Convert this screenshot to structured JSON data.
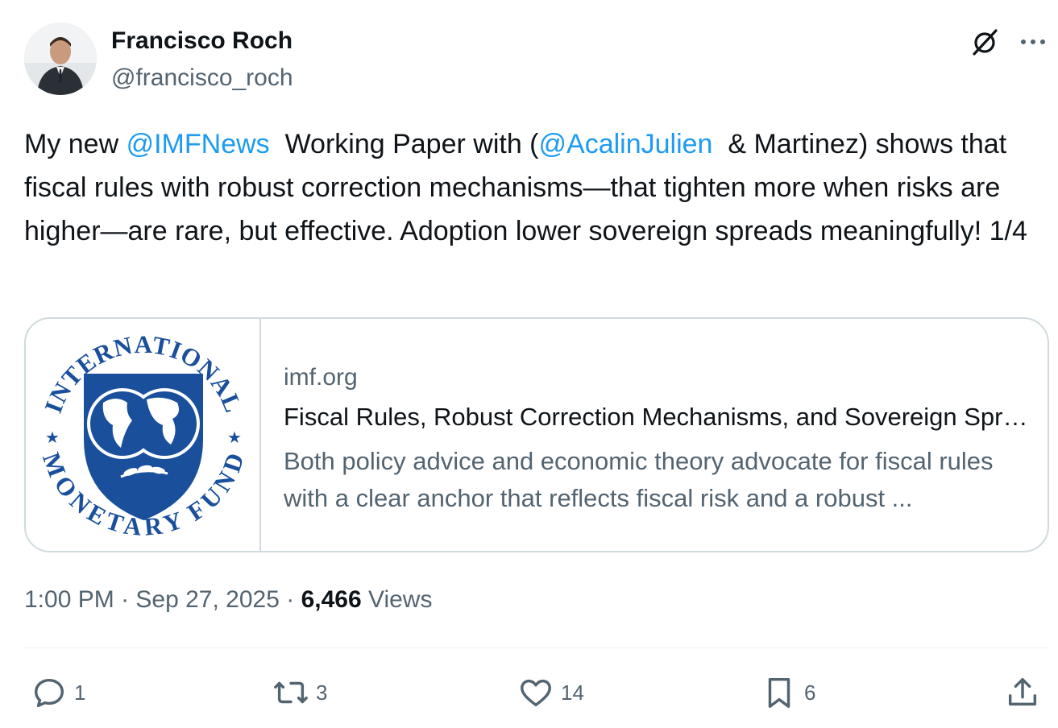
{
  "author": {
    "name": "Francisco Roch",
    "handle": "@francisco_roch"
  },
  "tweet": {
    "text_before_1": "My new ",
    "mention_1": "@IMFNews",
    "text_between": "  Working Paper with (",
    "mention_2": "@AcalinJulien",
    "text_after": "  & Martinez) shows that fiscal rules with robust correction mechanisms—that tighten more when risks are higher—are rare, but effective. Adoption lower sovereign spreads meaningfully! 1/4"
  },
  "card": {
    "logo_text_top": "INTERNATIONAL",
    "logo_text_bottom": "MONETARY FUND",
    "domain": "imf.org",
    "title": "Fiscal Rules, Robust Correction Mechanisms, and Sovereign Spreads",
    "description": "Both policy advice and economic theory advocate for fiscal rules with a clear anchor that reflects fiscal risk and a robust ..."
  },
  "meta": {
    "time": "1:00 PM",
    "separator": " · ",
    "date": "Sep 27, 2025",
    "views_count": "6,466",
    "views_label": " Views"
  },
  "actions": {
    "replies": "1",
    "reposts": "3",
    "likes": "14",
    "bookmarks": "6"
  },
  "icons": [
    "grok-icon",
    "more-icon",
    "reply-icon",
    "repost-icon",
    "like-icon",
    "bookmark-icon",
    "share-icon"
  ],
  "colors": {
    "link": "#1d9bf0",
    "secondary_text": "#536471",
    "primary_text": "#0f1419",
    "imf_blue": "#1a4f9c",
    "border": "#cfd9de"
  }
}
